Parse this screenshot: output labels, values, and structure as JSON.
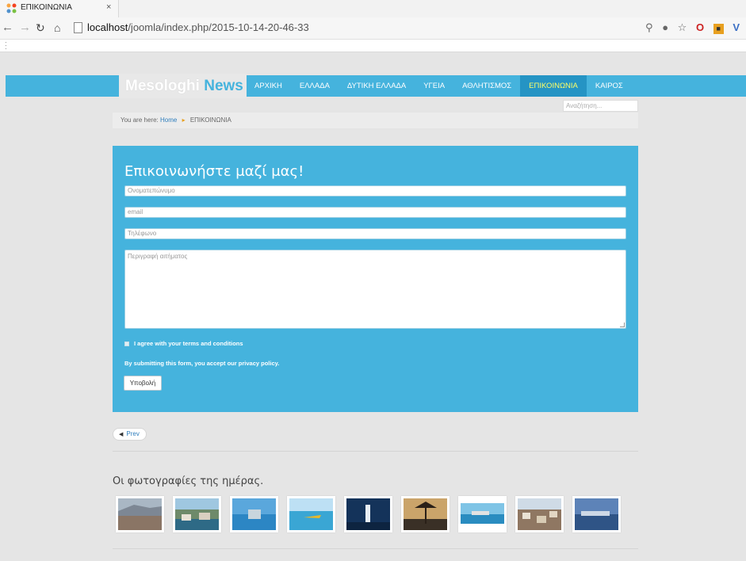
{
  "browser": {
    "tab_title": "ΕΠΙΚΟΙΝΩΝΙΑ",
    "tab_close": "×",
    "url_host": "localhost",
    "url_path": "/joomla/index.php/2015-10-14-20-46-33"
  },
  "site": {
    "logo_part1": "Mesologhi",
    "logo_part2": "News",
    "menu": [
      {
        "label": "ΑΡΧΙΚΗ"
      },
      {
        "label": "ΕΛΛΑΔΑ"
      },
      {
        "label": "ΔΥΤΙΚΗ ΕΛΛΑΔΑ"
      },
      {
        "label": "ΥΓΕΙΑ"
      },
      {
        "label": "ΑΘΛΗΤΙΣΜΟΣ"
      },
      {
        "label": "ΕΠΙΚΟΙΝΩΝΙΑ"
      },
      {
        "label": "ΚΑΙΡΟΣ"
      }
    ],
    "search_placeholder": "Αναζήτηση..."
  },
  "breadcrumb": {
    "prefix": "You are here:",
    "home": "Home",
    "current": "ΕΠΙΚΟΙΝΩΝΙΑ"
  },
  "form": {
    "title": "Επικοινωνήστε μαζί μας!",
    "name_placeholder": "Ονοματεπώνυμο",
    "email_placeholder": "email",
    "phone_placeholder": "Τηλέφωνο",
    "message_placeholder": "Περιγραφή αιτήματος",
    "agree_label": "I agree with your terms and conditions",
    "privacy_text": "By submitting this form, you accept our privacy policy.",
    "submit_label": "Υποβολή"
  },
  "pager": {
    "prev_label": "Prev"
  },
  "photos": {
    "title": "Οι φωτογραφίες της ημέρας."
  },
  "colors": {
    "brand_blue": "#45b3dd",
    "menu_active": "#2594c4",
    "menu_active_text": "#ffff66"
  }
}
